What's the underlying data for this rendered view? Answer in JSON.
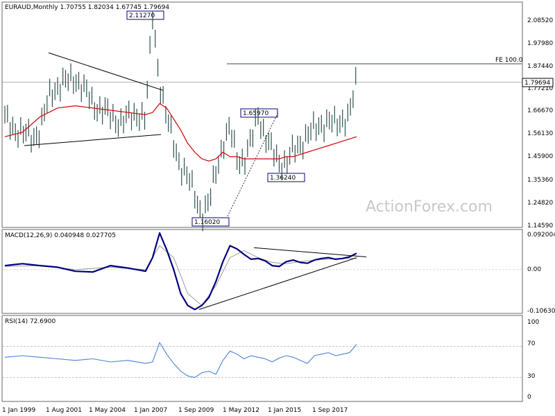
{
  "chart_data": {
    "type": "line",
    "watermark": "ActionForex.com",
    "x_ticks": [
      "1 Jan 1999",
      "1 Aug 2001",
      "1 May 2004",
      "1 Jan 2007",
      "1 Sep 2009",
      "1 May 2012",
      "1 Jan 2015",
      "1 Sep 2017"
    ],
    "price_panel": {
      "title": "EURAUD,Monthly  1.70755 1.82034 1.67745 1.79694",
      "y_ticks": [
        "2.08520",
        "1.97980",
        "1.87440",
        "1.77210",
        "1.66670",
        "1.56130",
        "1.45900",
        "1.35360",
        "1.24820",
        "1.14590"
      ],
      "ylim": [
        1.1459,
        2.15
      ],
      "current_price_label": "1.79694",
      "current_price": 1.79694,
      "fe_line_label": "FE 100.0",
      "fe_level": 1.88,
      "annotations": [
        "2.11270",
        "1.65970",
        "1.36240",
        "1.16020"
      ],
      "series": [
        {
          "name": "price",
          "color": "#2f4f4f",
          "t": [
            0,
            2,
            5,
            8,
            10,
            13,
            15,
            18,
            20,
            23,
            25,
            28,
            30,
            33,
            36,
            38,
            40,
            42,
            44,
            46,
            48,
            50,
            52,
            54,
            56,
            58,
            60,
            62,
            64,
            66,
            68,
            70,
            72,
            74,
            76,
            78,
            80,
            82,
            84,
            86,
            88,
            90,
            92,
            94,
            96,
            98,
            100
          ],
          "values": [
            1.63,
            1.6,
            1.56,
            1.55,
            1.58,
            1.75,
            1.78,
            1.8,
            1.82,
            1.75,
            1.7,
            1.67,
            1.64,
            1.62,
            1.64,
            1.66,
            1.63,
            2.1,
            1.8,
            1.63,
            1.52,
            1.42,
            1.36,
            1.29,
            1.2,
            1.24,
            1.4,
            1.52,
            1.58,
            1.46,
            1.44,
            1.52,
            1.66,
            1.55,
            1.48,
            1.44,
            1.43,
            1.48,
            1.52,
            1.56,
            1.58,
            1.61,
            1.62,
            1.6,
            1.63,
            1.65,
            1.8
          ]
        },
        {
          "name": "ma",
          "color": "#d00000",
          "t": [
            0,
            5,
            10,
            15,
            20,
            25,
            30,
            35,
            40,
            42,
            44,
            46,
            48,
            50,
            52,
            54,
            56,
            58,
            60,
            62,
            64,
            66,
            68,
            70,
            72,
            74,
            76,
            78,
            80,
            82,
            84,
            86,
            88,
            90,
            92,
            94,
            96,
            98,
            100
          ],
          "values": [
            1.55,
            1.57,
            1.64,
            1.68,
            1.69,
            1.68,
            1.67,
            1.66,
            1.65,
            1.66,
            1.7,
            1.68,
            1.63,
            1.58,
            1.52,
            1.48,
            1.45,
            1.44,
            1.45,
            1.48,
            1.46,
            1.46,
            1.45,
            1.45,
            1.45,
            1.45,
            1.45,
            1.45,
            1.46,
            1.46,
            1.47,
            1.48,
            1.49,
            1.5,
            1.51,
            1.52,
            1.53,
            1.54,
            1.55
          ]
        }
      ]
    },
    "macd_panel": {
      "title": "MACD(12,26,9) 0.040948 0.027705",
      "y_ticks": [
        "0.092004",
        "0.00",
        "-0.106308"
      ],
      "ylim": [
        -0.1063,
        0.092
      ],
      "series": [
        {
          "name": "macd",
          "color": "#00007f",
          "t": [
            0,
            5,
            10,
            15,
            20,
            25,
            30,
            35,
            40,
            42,
            44,
            46,
            48,
            50,
            52,
            54,
            56,
            58,
            60,
            62,
            64,
            66,
            68,
            70,
            72,
            74,
            76,
            78,
            80,
            82,
            84,
            86,
            88,
            90,
            92,
            94,
            96,
            98,
            100
          ],
          "values": [
            0.01,
            0.015,
            0.01,
            0.006,
            -0.004,
            -0.006,
            0.01,
            0.004,
            -0.004,
            0.03,
            0.092,
            0.05,
            0.0,
            -0.06,
            -0.09,
            -0.1,
            -0.09,
            -0.07,
            -0.03,
            0.02,
            0.06,
            0.052,
            0.038,
            0.026,
            0.028,
            0.022,
            0.01,
            0.008,
            0.02,
            0.024,
            0.018,
            0.016,
            0.024,
            0.028,
            0.03,
            0.026,
            0.028,
            0.032,
            0.041
          ]
        },
        {
          "name": "signal",
          "color": "#9a9a9a",
          "t": [
            0,
            10,
            20,
            30,
            40,
            44,
            48,
            52,
            56,
            60,
            64,
            68,
            72,
            76,
            80,
            84,
            88,
            92,
            96,
            100
          ],
          "values": [
            0.008,
            0.01,
            0.0,
            0.006,
            0.0,
            0.06,
            0.03,
            -0.06,
            -0.09,
            -0.04,
            0.03,
            0.048,
            0.03,
            0.018,
            0.015,
            0.02,
            0.024,
            0.026,
            0.028,
            0.028
          ]
        }
      ]
    },
    "rsi_panel": {
      "title": "RSI(14) 72.6900",
      "y_ticks": [
        "100",
        "70",
        "30",
        "0"
      ],
      "ylim": [
        0,
        100
      ],
      "levels": [
        70,
        30
      ],
      "series": [
        {
          "name": "rsi",
          "color": "#4682d8",
          "t": [
            0,
            5,
            10,
            15,
            20,
            25,
            30,
            35,
            40,
            42,
            44,
            46,
            48,
            50,
            52,
            54,
            56,
            58,
            60,
            62,
            64,
            66,
            68,
            70,
            72,
            74,
            76,
            78,
            80,
            82,
            84,
            86,
            88,
            90,
            92,
            94,
            96,
            98,
            100
          ],
          "values": [
            56,
            58,
            56,
            54,
            52,
            54,
            50,
            52,
            48,
            50,
            75,
            60,
            48,
            38,
            32,
            30,
            36,
            38,
            34,
            52,
            64,
            60,
            54,
            58,
            56,
            54,
            50,
            55,
            58,
            56,
            52,
            48,
            58,
            60,
            62,
            58,
            60,
            62,
            72.69
          ]
        }
      ]
    }
  }
}
